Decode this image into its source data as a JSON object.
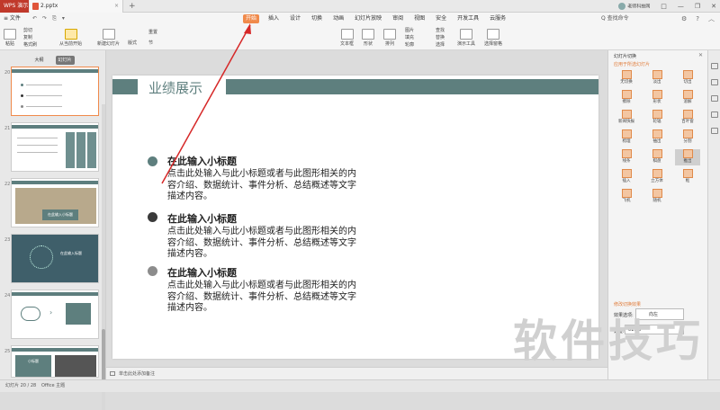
{
  "titlebar": {
    "app_tab": "WPS 演示",
    "doc_tab": "2.pptx",
    "plus": "+",
    "account": "老师科技网",
    "win_buttons": [
      "□",
      "—",
      "❐",
      "✕"
    ]
  },
  "menu": {
    "file": "≡ 文件",
    "qat": [
      "↶",
      "↷",
      "⎘",
      "▾"
    ],
    "tabs": [
      "开始",
      "插入",
      "设计",
      "切换",
      "动画",
      "幻灯片放映",
      "审阅",
      "视图",
      "安全",
      "开发工具",
      "云服务"
    ],
    "active_tab": "开始",
    "search": "Q 查找命令",
    "right_icons": [
      "⚙",
      "?",
      "︿"
    ]
  },
  "ribbon": {
    "paste": "粘贴",
    "cut": "剪切",
    "copy": "复制",
    "format_painter": "格式刷",
    "from_current": "从当前开始",
    "new_slide": "新建幻灯片",
    "layout": "版式",
    "reset": "重置",
    "section": "节",
    "font_size": "0",
    "format_buttons": [
      "B",
      "I",
      "U",
      "S",
      "X²",
      "X₂",
      "A"
    ],
    "textbox": "文本框",
    "shape": "形状",
    "arrange": "排列",
    "picture": "图片",
    "fill": "填充",
    "outline": "轮廓",
    "find": "查找",
    "replace": "替换",
    "select": "选择",
    "presenter": "演示工具",
    "select_pane": "选择窗格"
  },
  "left_panel": {
    "tabs": [
      "大纲",
      "幻灯片"
    ],
    "active_tab": "幻灯片",
    "thumb_numbers": [
      "20",
      "21",
      "22",
      "23",
      "24",
      "25"
    ],
    "thumb3_caption": "在此输入小标题",
    "thumb4_caption": "在此输入标题",
    "thumb6_caption": "小标题"
  },
  "slide": {
    "title": "业绩展示",
    "items": [
      {
        "heading": "在此输入小标题",
        "body": "点击此处输入与此小标题或者与此图形相关的内容介绍、数据统计、事件分析、总结概述等文字描述内容。",
        "color": "#5e7f7e"
      },
      {
        "heading": "在此输入小标题",
        "body": "点击此处输入与此小标题或者与此图形相关的内容介绍、数据统计、事件分析、总结概述等文字描述内容。",
        "color": "#3a3a3a"
      },
      {
        "heading": "在此输入小标题",
        "body": "点击此处输入与此小标题或者与此图形相关的内容介绍、数据统计、事件分析、总结概述等文字描述内容。",
        "color": "#8c8c8c"
      }
    ]
  },
  "notes": "单击此处添加备注",
  "right_panel": {
    "title": "幻灯片切换",
    "subtitle": "应用于所选幻灯片",
    "close": "✕",
    "transitions": [
      "无切换",
      "淡出",
      "切出",
      "擦除",
      "形状",
      "溶解",
      "新闻快报",
      "轮辐",
      "百叶窗",
      "梳理",
      "抽出",
      "分割",
      "线条",
      "棋盘",
      "推出",
      "插入",
      "立方体",
      "框",
      "飞机",
      "随机"
    ],
    "selected_transition": "推出",
    "modify_label": "修改切换效果",
    "effect_label": "效果选项:",
    "effect_value": "向左",
    "speed_label": "速度:",
    "speed_value": "01.00"
  },
  "status": {
    "slide_count": "幻灯片 20 / 28",
    "theme": "Office 主题"
  },
  "watermark": "软件技巧",
  "colors": {
    "accent": "#f08a4b",
    "theme_teal": "#5e7f7e"
  }
}
